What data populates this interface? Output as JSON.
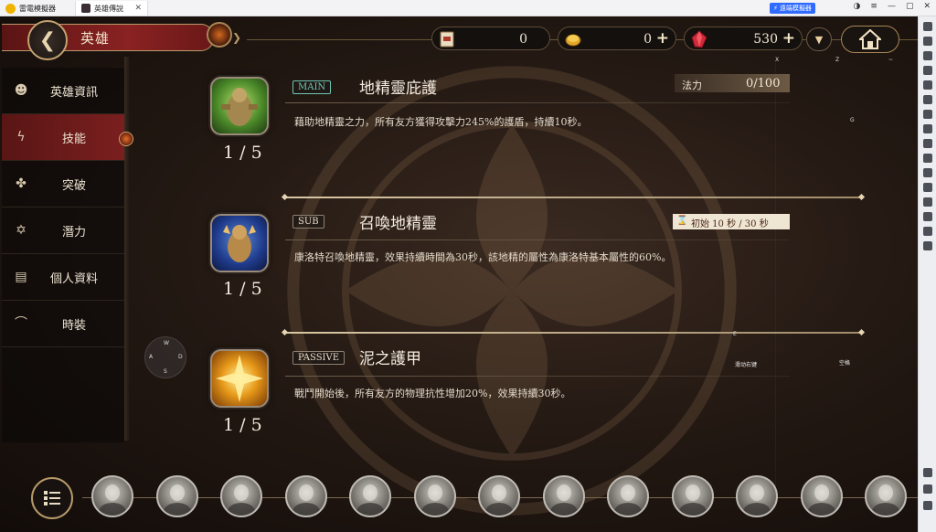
{
  "emulator": {
    "app_tab_label": "雷電模擬器",
    "game_tab_label": "英雄傳說",
    "tab_close": "✕",
    "boost_label": "遠端模擬器",
    "window_controls": [
      "◑",
      "≡",
      "—",
      "▢",
      "✕"
    ]
  },
  "header": {
    "back_icon": "arrow-left-icon",
    "title": "英雄",
    "currencies": [
      {
        "name": "scroll",
        "icon": "scroll-icon",
        "value": "0"
      },
      {
        "name": "gold",
        "icon": "gold-coin-icon",
        "value": "0",
        "plus": "+"
      },
      {
        "name": "gem",
        "icon": "red-crystal-icon",
        "value": "530",
        "plus": "+"
      }
    ],
    "dropdown_icon": "chevron-down-icon",
    "home_icon": "home-icon"
  },
  "key_hints": {
    "x": "X",
    "z": "Z",
    "tilde": "~",
    "g": "G",
    "e": "E",
    "space": "空格",
    "scroll_lock": "滑动右键"
  },
  "sidebar": {
    "items": [
      {
        "label": "英雄資訊",
        "icon": "hero-info-icon",
        "active": false
      },
      {
        "label": "技能",
        "icon": "lightning-icon",
        "active": true
      },
      {
        "label": "突破",
        "icon": "clover-icon",
        "active": false
      },
      {
        "label": "潛力",
        "icon": "star-of-david-icon",
        "active": false
      },
      {
        "label": "個人資料",
        "icon": "profile-doc-icon",
        "active": false
      },
      {
        "label": "時裝",
        "icon": "hanger-icon",
        "active": false
      }
    ]
  },
  "skills": [
    {
      "type_tag": "MAIN",
      "name": "地精靈庇護",
      "level": "1 / 5",
      "description": "藉助地精靈之力，所有友方獲得攻擊力245%的護盾，持續10秒。",
      "cost_label": "法力",
      "cost_value": "0/100"
    },
    {
      "type_tag": "SUB",
      "name": "召喚地精靈",
      "level": "1 / 5",
      "description": "康洛特召喚地精靈，效果持續時間為30秒，該地精的屬性為康洛特基本屬性的60%。",
      "cooldown": "初始 10 秒 / 30 秒"
    },
    {
      "type_tag": "PASSIVE",
      "name": "泥之護甲",
      "level": "1 / 5",
      "description": "戰鬥開始後，所有友方的物理抗性增加20%，效果持續30秒。"
    }
  ],
  "dpad": {
    "w": "W",
    "a": "A",
    "s": "S",
    "d": "D"
  },
  "hero_bar": {
    "menu_icon": "list-menu-icon",
    "portrait_count": 13
  },
  "colors": {
    "accent_red": "#7a1f1f",
    "gold_border": "#b89a6a",
    "main_tag": "#6fc6b4"
  }
}
